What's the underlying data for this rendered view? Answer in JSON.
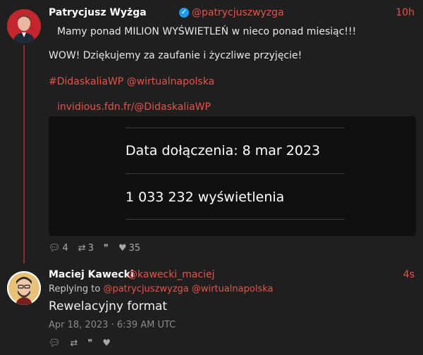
{
  "tweet1": {
    "name": "Patrycjusz Wyżga",
    "handle": "@patrycjuszwyzga",
    "time": "10h",
    "line1": "Mamy ponad MILION WYŚWIETLEŃ w nieco ponad miesiąc!!!",
    "line2": "WOW! Dziękujemy za zaufanie i życzliwe przyjęcie!",
    "hashtag": "#DidaskaliaWP",
    "mention": "@wirtualnapolska",
    "link": "invidious.fdn.fr/@DidaskaliaWP",
    "embed": {
      "joined": "Data dołączenia: 8 mar 2023",
      "views": "1 033 232 wyświetlenia"
    },
    "stats": {
      "replies": "4",
      "retweets": "3",
      "quotes": "",
      "likes": "35"
    }
  },
  "tweet2": {
    "name": "Maciej Kawecki",
    "handle": "@kawecki_maciej",
    "time": "4s",
    "replying_label": "Replying to",
    "replying_to_1": "@patrycjuszwyzga",
    "replying_to_2": "@wirtualnapolska",
    "text": "Rewelacyjny format",
    "date": "Apr 18, 2023 · 6:39 AM UTC"
  },
  "icons": {
    "reply": "reply-icon",
    "retweet": "retweet-icon",
    "quote": "quote-icon",
    "like": "heart-icon",
    "verified": "verified-badge-icon"
  },
  "colors": {
    "accent": "#e8524a",
    "background": "#1f1f1f",
    "verified": "#1d9bf0"
  }
}
